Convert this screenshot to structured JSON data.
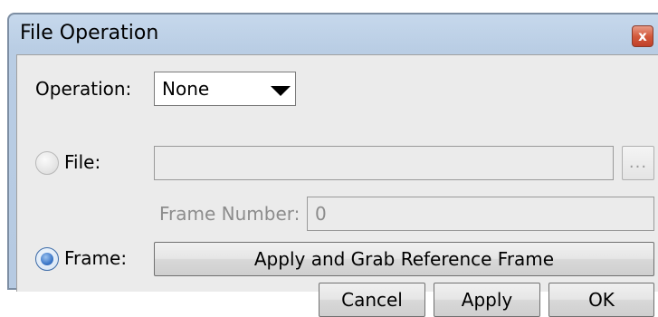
{
  "window": {
    "title": "File Operation",
    "close_label": "x"
  },
  "operation": {
    "label": "Operation:",
    "selected": "None"
  },
  "file": {
    "label": "File:",
    "path_value": "",
    "browse_label": "...",
    "checked": false
  },
  "frame_number": {
    "label": "Frame Number:",
    "value": "0"
  },
  "frame": {
    "label": "Frame:",
    "grab_label": "Apply and Grab Reference Frame",
    "checked": true
  },
  "buttons": {
    "cancel": "Cancel",
    "apply": "Apply",
    "ok": "OK"
  }
}
